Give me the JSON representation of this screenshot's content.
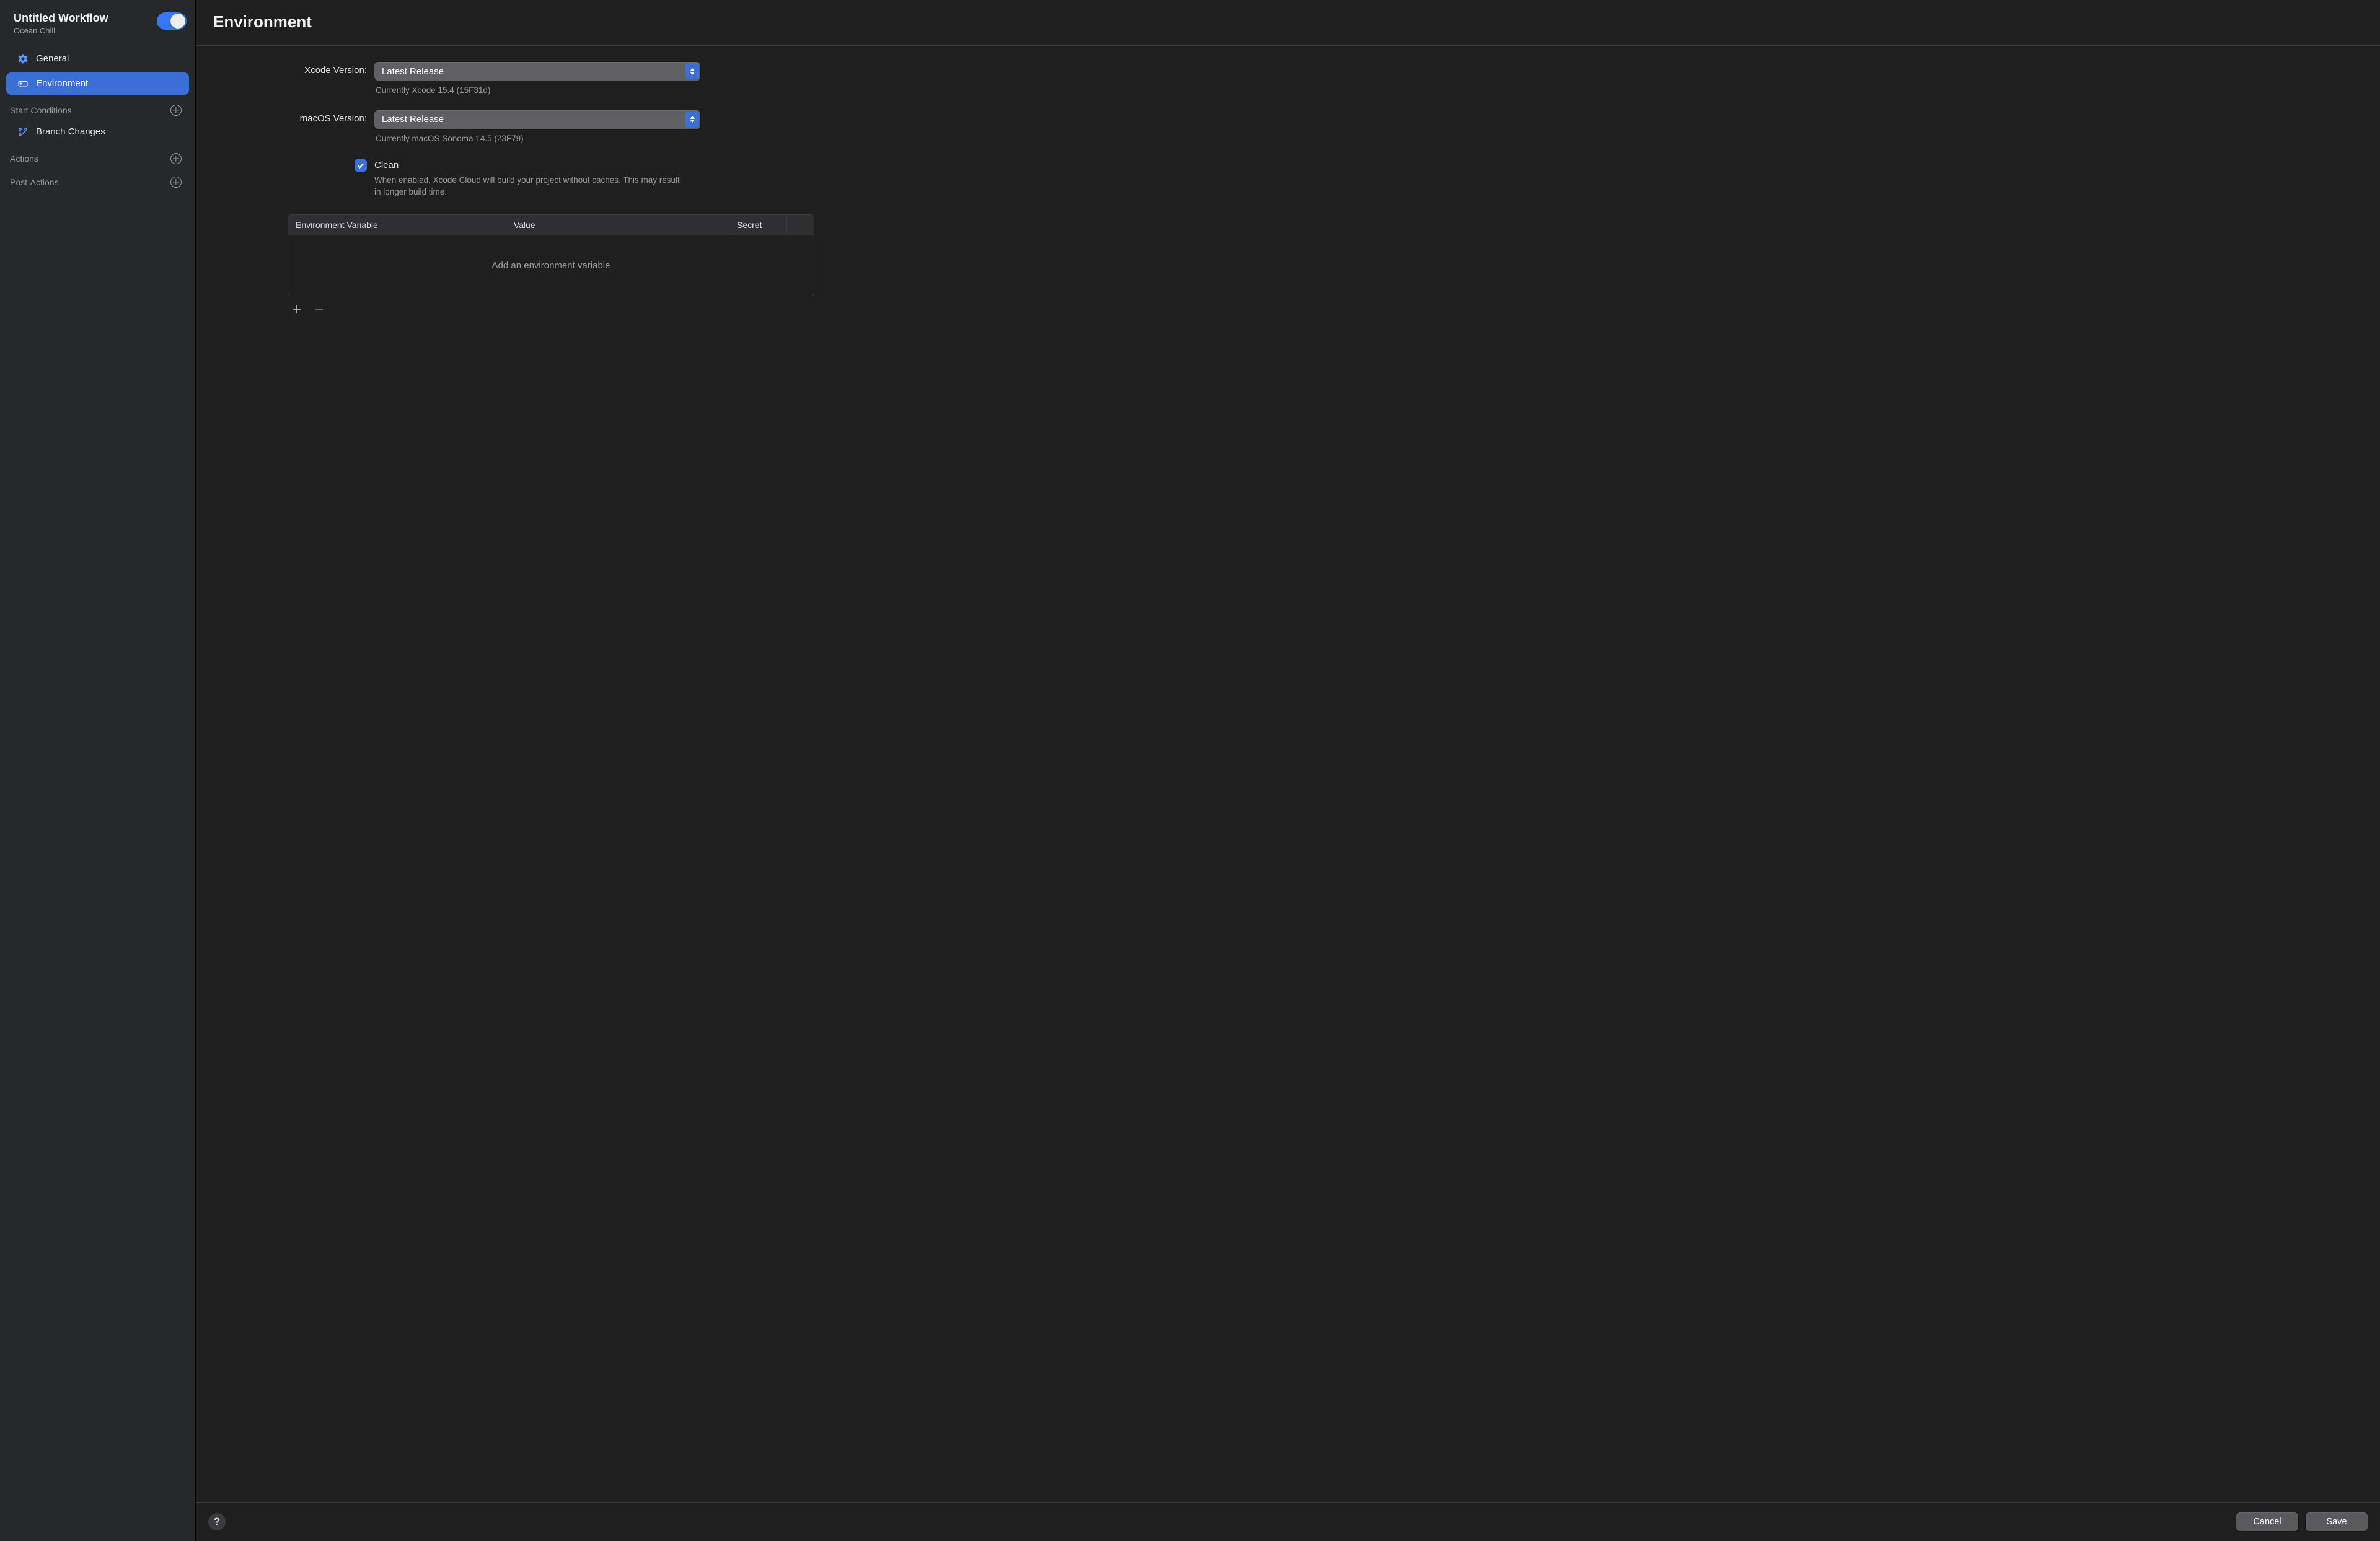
{
  "sidebar": {
    "title": "Untitled Workflow",
    "subtitle": "Ocean Chill",
    "toggle_on": true,
    "nav": [
      {
        "label": "General",
        "icon": "gear-icon"
      },
      {
        "label": "Environment",
        "icon": "drive-icon",
        "active": true
      }
    ],
    "sections": [
      {
        "header": "Start Conditions",
        "items": [
          {
            "label": "Branch Changes",
            "icon": "branch-icon"
          }
        ]
      },
      {
        "header": "Actions",
        "items": []
      },
      {
        "header": "Post-Actions",
        "items": []
      }
    ]
  },
  "main": {
    "title": "Environment",
    "xcode": {
      "label": "Xcode Version:",
      "value": "Latest Release",
      "note": "Currently Xcode 15.4 (15F31d)"
    },
    "macos": {
      "label": "macOS Version:",
      "value": "Latest Release",
      "note": "Currently macOS Sonoma 14.5 (23F79)"
    },
    "clean": {
      "checked": true,
      "label": "Clean",
      "desc": "When enabled, Xcode Cloud will build your project without caches. This may result in longer build time."
    },
    "env_table": {
      "columns": [
        "Environment Variable",
        "Value",
        "Secret"
      ],
      "empty_text": "Add an environment variable"
    }
  },
  "footer": {
    "cancel": "Cancel",
    "save": "Save"
  }
}
